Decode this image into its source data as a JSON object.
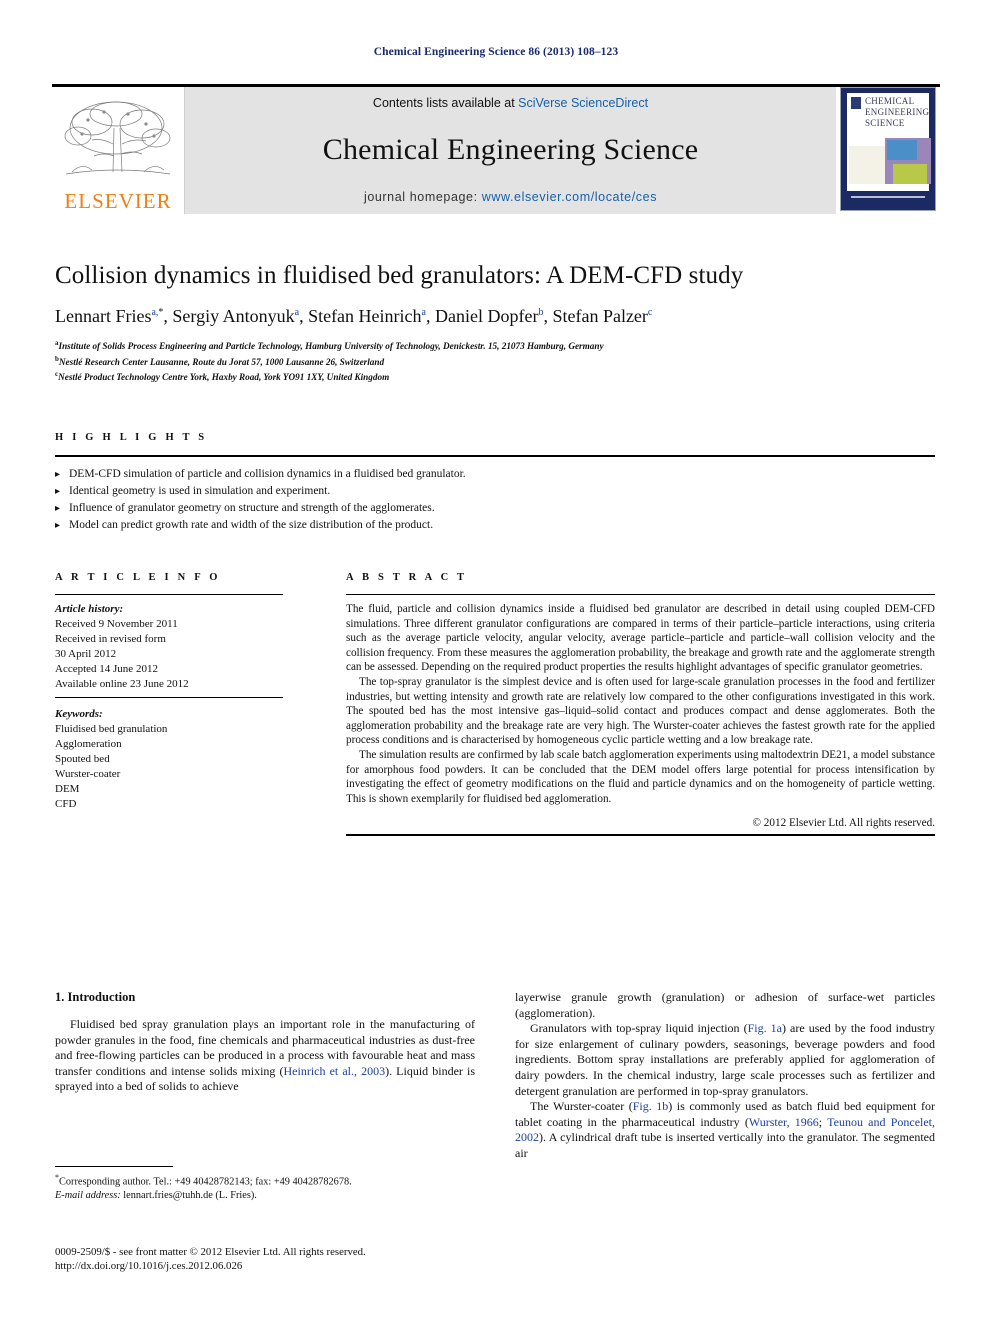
{
  "running_head": "Chemical Engineering Science 86 (2013) 108–123",
  "banner": {
    "contents_prefix": "Contents lists available at ",
    "contents_link": "SciVerse ScienceDirect",
    "journal_title": "Chemical Engineering Science",
    "homepage_prefix": "journal homepage: ",
    "homepage_url": "www.elsevier.com/locate/ces",
    "publisher_wordmark": "ELSEVIER",
    "cover_title": "CHEMICAL ENGINEERING SCIENCE",
    "accent_orange": "#f07f13",
    "link_blue": "#1560a8",
    "cover_navy": "#1b2a62"
  },
  "title": "Collision dynamics in fluidised bed granulators: A DEM-CFD study",
  "authors": [
    {
      "name": "Lennart Fries",
      "sup": "a,",
      "star": "*"
    },
    {
      "name": "Sergiy Antonyuk",
      "sup": "a",
      "star": ""
    },
    {
      "name": "Stefan Heinrich",
      "sup": "a",
      "star": ""
    },
    {
      "name": "Daniel Dopfer",
      "sup": "b",
      "star": ""
    },
    {
      "name": "Stefan Palzer",
      "sup": "c",
      "star": ""
    }
  ],
  "affiliations": [
    {
      "marker": "a",
      "text": "Institute of Solids Process Engineering and Particle Technology, Hamburg University of Technology, Denickestr. 15, 21073 Hamburg, Germany"
    },
    {
      "marker": "b",
      "text": "Nestlé Research Center Lausanne, Route du Jorat 57, 1000 Lausanne 26, Switzerland"
    },
    {
      "marker": "c",
      "text": "Nestlé Product Technology Centre York, Haxby Road, York YO91 1XY, United Kingdom"
    }
  ],
  "highlights": {
    "label": "H I G H L I G H T S",
    "items": [
      "DEM-CFD simulation of particle and collision dynamics in a fluidised bed granulator.",
      "Identical geometry is used in simulation and experiment.",
      "Influence of granulator geometry on structure and strength of the agglomerates.",
      "Model can predict growth rate and width of the size distribution of the product."
    ]
  },
  "article_info": {
    "label": "A R T I C L E   I N F O",
    "history_title": "Article history:",
    "history": [
      "Received 9 November 2011",
      "Received in revised form",
      "30 April 2012",
      "Accepted 14 June 2012",
      "Available online 23 June 2012"
    ],
    "keywords_title": "Keywords:",
    "keywords": [
      "Fluidised bed granulation",
      "Agglomeration",
      "Spouted bed",
      "Wurster-coater",
      "DEM",
      "CFD"
    ]
  },
  "abstract": {
    "label": "A B S T R A C T",
    "paragraphs": [
      "The fluid, particle and collision dynamics inside a fluidised bed granulator are described in detail using coupled DEM-CFD simulations. Three different granulator configurations are compared in terms of their particle–particle interactions, using criteria such as the average particle velocity, angular velocity, average particle–particle and particle–wall collision velocity and the collision frequency. From these measures the agglomeration probability, the breakage and growth rate and the agglomerate strength can be assessed. Depending on the required product properties the results highlight advantages of specific granulator geometries.",
      "The top-spray granulator is the simplest device and is often used for large-scale granulation processes in the food and fertilizer industries, but wetting intensity and growth rate are relatively low compared to the other configurations investigated in this work. The spouted bed has the most intensive gas–liquid–solid contact and produces compact and dense agglomerates. Both the agglomeration probability and the breakage rate are very high. The Wurster-coater achieves the fastest growth rate for the applied process conditions and is characterised by homogeneous cyclic particle wetting and a low breakage rate.",
      "The simulation results are confirmed by lab scale batch agglomeration experiments using maltodextrin DE21, a model substance for amorphous food powders. It can be concluded that the DEM model offers large potential for process intensification by investigating the effect of geometry modifications on the fluid and particle dynamics and on the homogeneity of particle wetting. This is shown exemplarily for fluidised bed agglomeration."
    ],
    "copyright": "© 2012 Elsevier Ltd. All rights reserved."
  },
  "body": {
    "section_heading": "1.  Introduction",
    "left_paragraphs": [
      "Fluidised bed spray granulation plays an important role in the manufacturing of powder granules in the food, fine chemicals and pharmaceutical industries as dust-free and free-flowing particles can be produced in a process with favourable heat and mass transfer conditions and intense solids mixing (Heinrich et al., 2003). Liquid binder is sprayed into a bed of solids to achieve"
    ],
    "right_paragraphs": [
      "layerwise granule growth (granulation) or adhesion of surface-wet particles (agglomeration).",
      "Granulators with top-spray liquid injection (Fig. 1a) are used by the food industry for size enlargement of culinary powders, seasonings, beverage powders and food ingredients. Bottom spray installations are preferably applied for agglomeration of dairy powders. In the chemical industry, large scale processes such as fertilizer and detergent granulation are performed in top-spray granulators.",
      "The Wurster-coater (Fig. 1b) is commonly used as batch fluid bed equipment for tablet coating in the pharmaceutical industry (Wurster, 1966; Teunou and Poncelet, 2002). A cylindrical draft tube is inserted vertically into the granulator. The segmented air"
    ],
    "references_inline": [
      "Heinrich et al., 2003",
      "Fig. 1a",
      "Fig. 1b",
      "Wurster, 1966",
      "Teunou and Poncelet, 2002"
    ]
  },
  "footnotes": {
    "corresponding": "Corresponding author. Tel.: +49 40428782143; fax: +49 40428782678.",
    "email_label": "E-mail address:",
    "email": "lennart.fries@tuhh.de (L. Fries).",
    "issn_line": "0009-2509/$ - see front matter © 2012 Elsevier Ltd. All rights reserved.",
    "doi_line": "http://dx.doi.org/10.1016/j.ces.2012.06.026"
  }
}
